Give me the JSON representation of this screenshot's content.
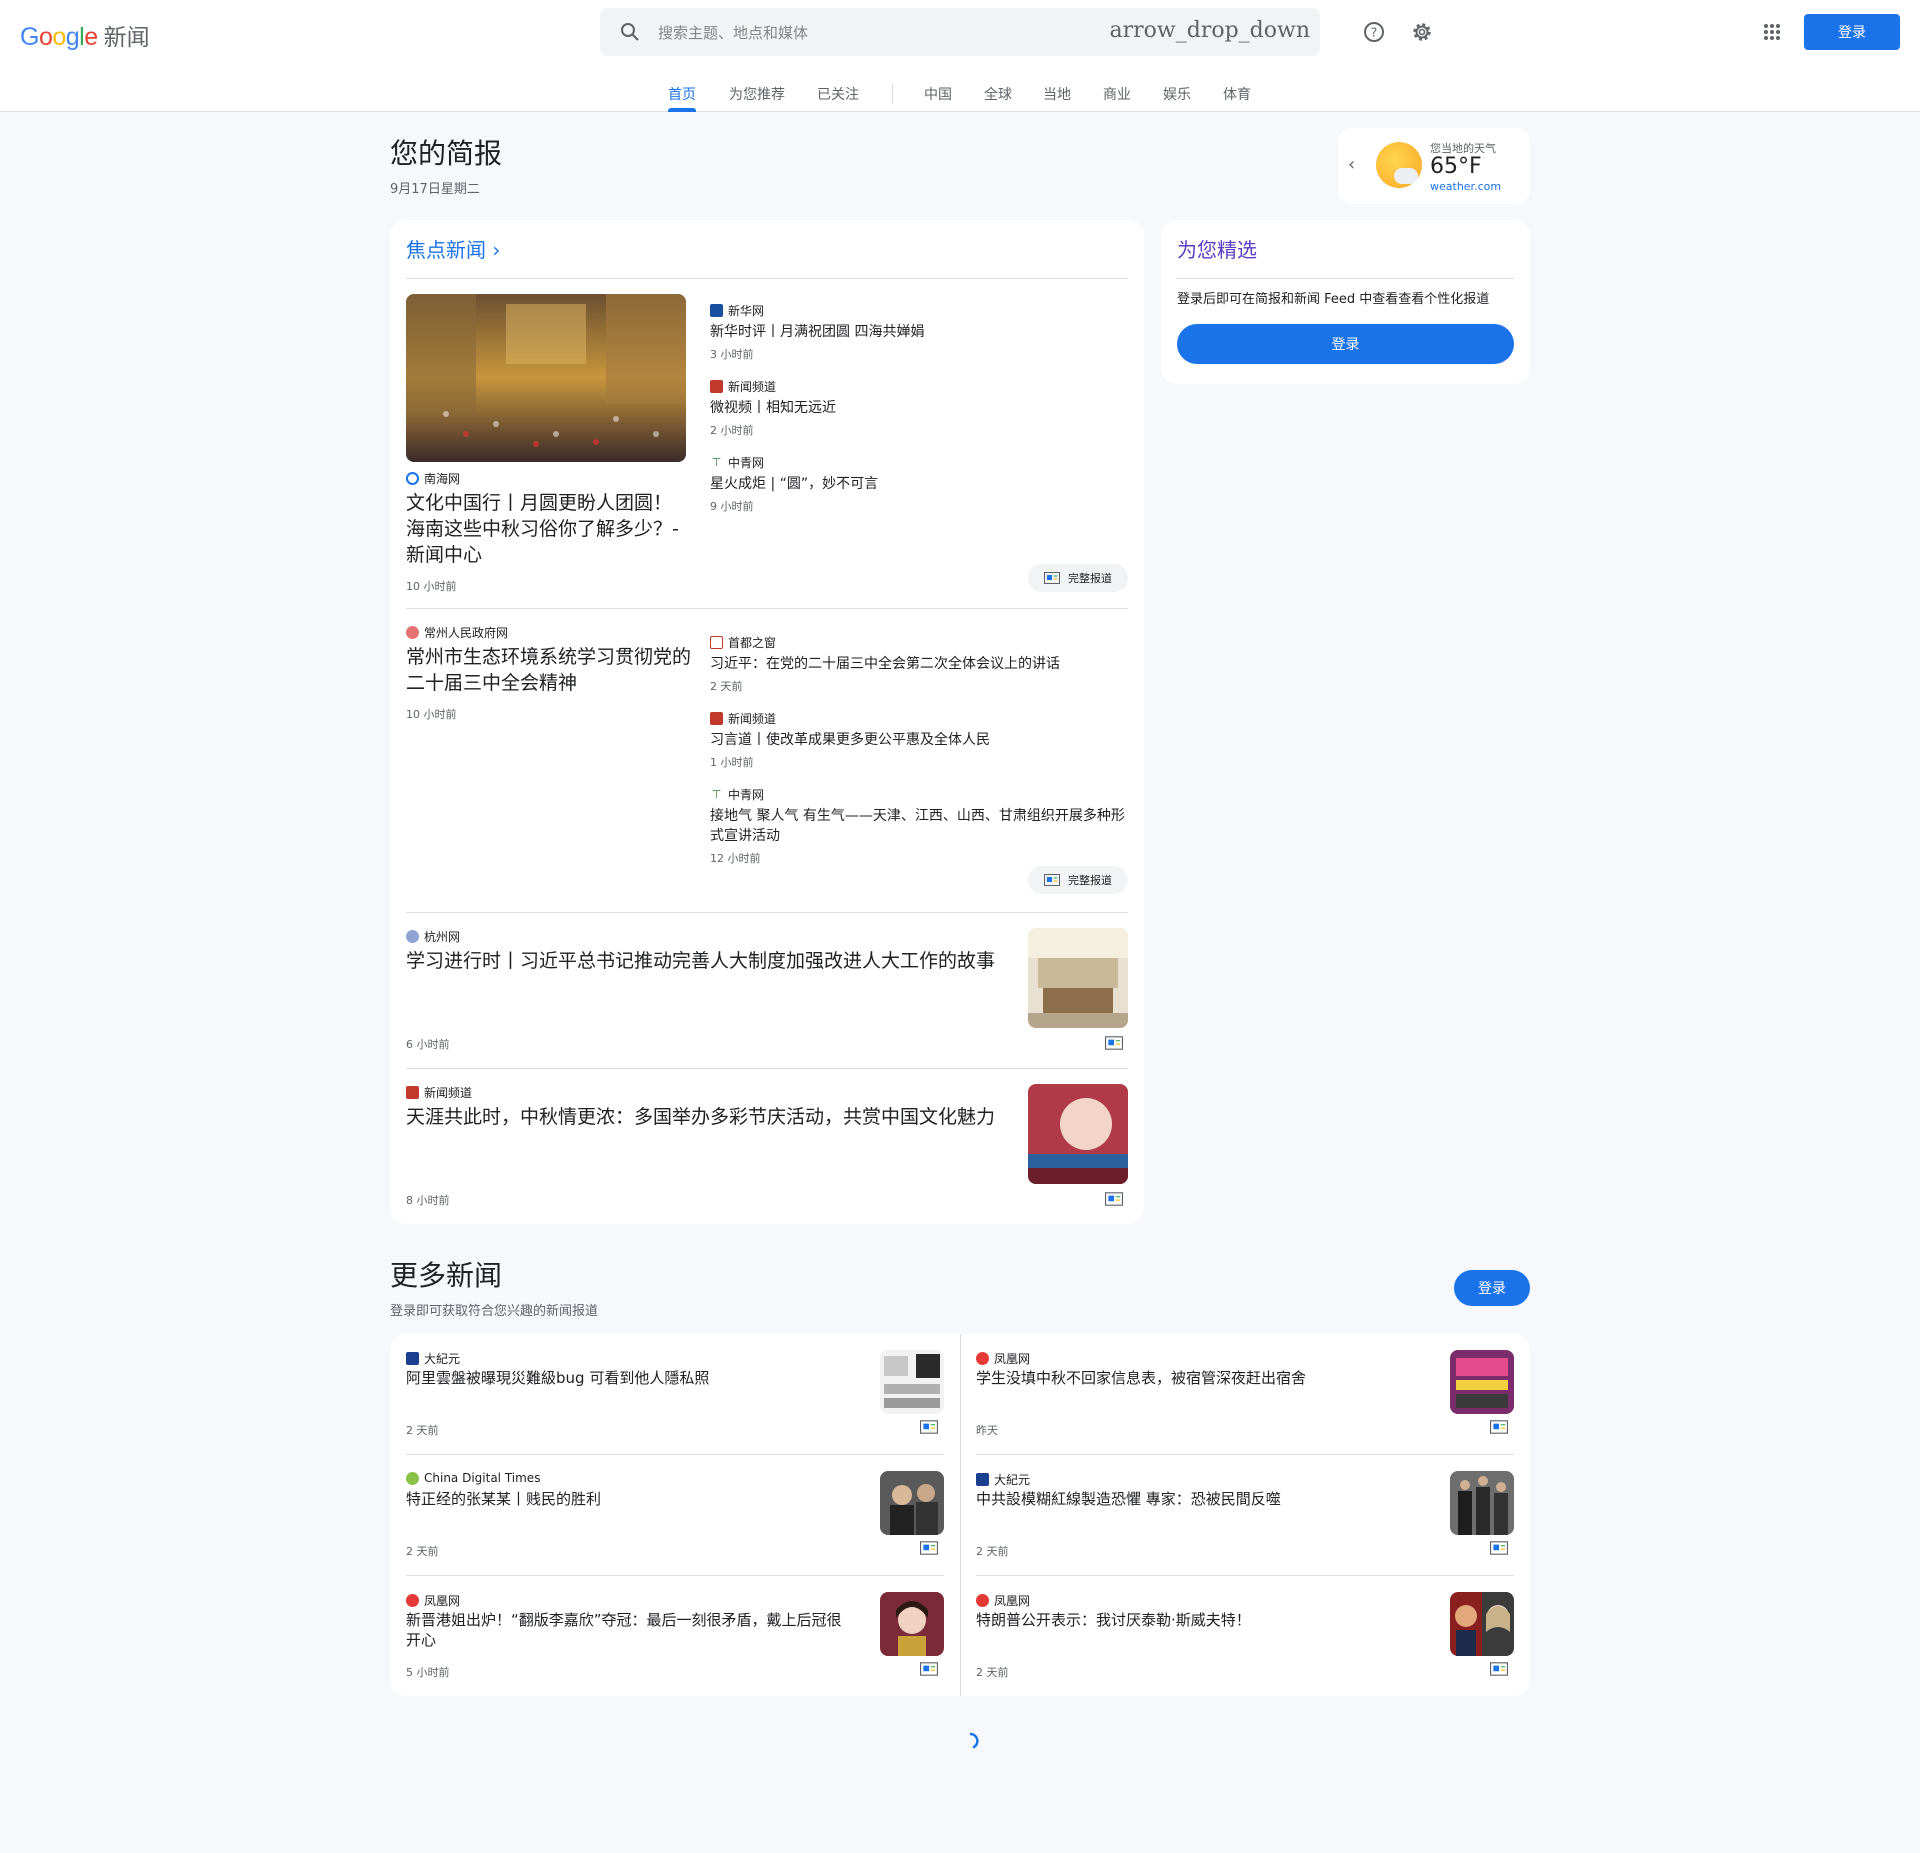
{
  "header": {
    "logo_google": "Google",
    "logo_news": "新闻",
    "search_placeholder": "搜索主题、地点和媒体",
    "search_dropdown_text": "arrow_drop_down",
    "signin": "登录",
    "tabs": [
      "首页",
      "为您推荐",
      "已关注",
      "中国",
      "全球",
      "当地",
      "商业",
      "娱乐",
      "体育"
    ],
    "active_tab": "首页"
  },
  "briefing": {
    "title": "您的简报",
    "date": "9月17日星期二"
  },
  "weather": {
    "label": "您当地的天气",
    "temp": "65°F",
    "source": "weather.com"
  },
  "top_stories": {
    "title": "焦点新闻",
    "full_coverage": "完整报道",
    "cluster1": {
      "main": {
        "publisher": "南海网",
        "title": "文化中国行丨月圆更盼人团圆！海南这些中秋习俗你了解多少？-新闻中心",
        "time": "10 小时前"
      },
      "related": [
        {
          "publisher": "新华网",
          "title": "新华时评丨月满祝团圆 四海共婵娟",
          "time": "3 小时前"
        },
        {
          "publisher": "新闻频道",
          "title": "微视频丨相知无远近",
          "time": "2 小时前"
        },
        {
          "publisher": "中青网",
          "title": "星火成炬 | “圆”，妙不可言",
          "time": "9 小时前"
        }
      ]
    },
    "cluster2": {
      "main": {
        "publisher": "常州人民政府网",
        "title": "常州市生态环境系统学习贯彻党的二十届三中全会精神",
        "time": "10 小时前"
      },
      "related": [
        {
          "publisher": "首都之窗",
          "title": "习近平：在党的二十届三中全会第二次全体会议上的讲话",
          "time": "2 天前"
        },
        {
          "publisher": "新闻频道",
          "title": "习言道丨使改革成果更多更公平惠及全体人民",
          "time": "1 小时前"
        },
        {
          "publisher": "中青网",
          "title": "接地气 聚人气 有生气——天津、江西、山西、甘肃组织开展多种形式宣讲活动",
          "time": "12 小时前"
        }
      ]
    },
    "single": [
      {
        "publisher": "杭州网",
        "title": "学习进行时丨习近平总书记推动完善人大制度加强改进人大工作的故事",
        "time": "6 小时前"
      },
      {
        "publisher": "新闻频道",
        "title": "天涯共此时，中秋情更浓：多国举办多彩节庆活动，共赏中国文化魅力",
        "time": "8 小时前"
      }
    ]
  },
  "picks": {
    "title": "为您精选",
    "desc": "登录后即可在简报和新闻 Feed 中查看查看个性化报道",
    "signin": "登录"
  },
  "more_news": {
    "title": "更多新闻",
    "subtitle": "登录即可获取符合您兴趣的新闻报道",
    "signin": "登录",
    "items": [
      {
        "publisher": "大紀元",
        "title": "阿里雲盤被曝現災難級bug 可看到他人隱私照",
        "time": "2 天前"
      },
      {
        "publisher": "凤凰网",
        "title": "学生没填中秋不回家信息表，被宿管深夜赶出宿舍",
        "time": "昨天"
      },
      {
        "publisher": "China Digital Times",
        "title": "特正经的张某某丨贱民的胜利",
        "time": "2 天前"
      },
      {
        "publisher": "大紀元",
        "title": "中共設模糊紅線製造恐懼 專家：恐被民間反噬",
        "time": "2 天前"
      },
      {
        "publisher": "凤凰网",
        "title": "新晋港姐出炉！“翻版李嘉欣”夺冠：最后一刻很矛盾，戴上后冠很开心",
        "time": "5 小时前"
      },
      {
        "publisher": "凤凰网",
        "title": "特朗普公开表示：我讨厌泰勒·斯威夫特！",
        "time": "2 天前"
      }
    ]
  },
  "colors": {
    "accent": "#1a73e8",
    "background": "#f6f8fc"
  }
}
